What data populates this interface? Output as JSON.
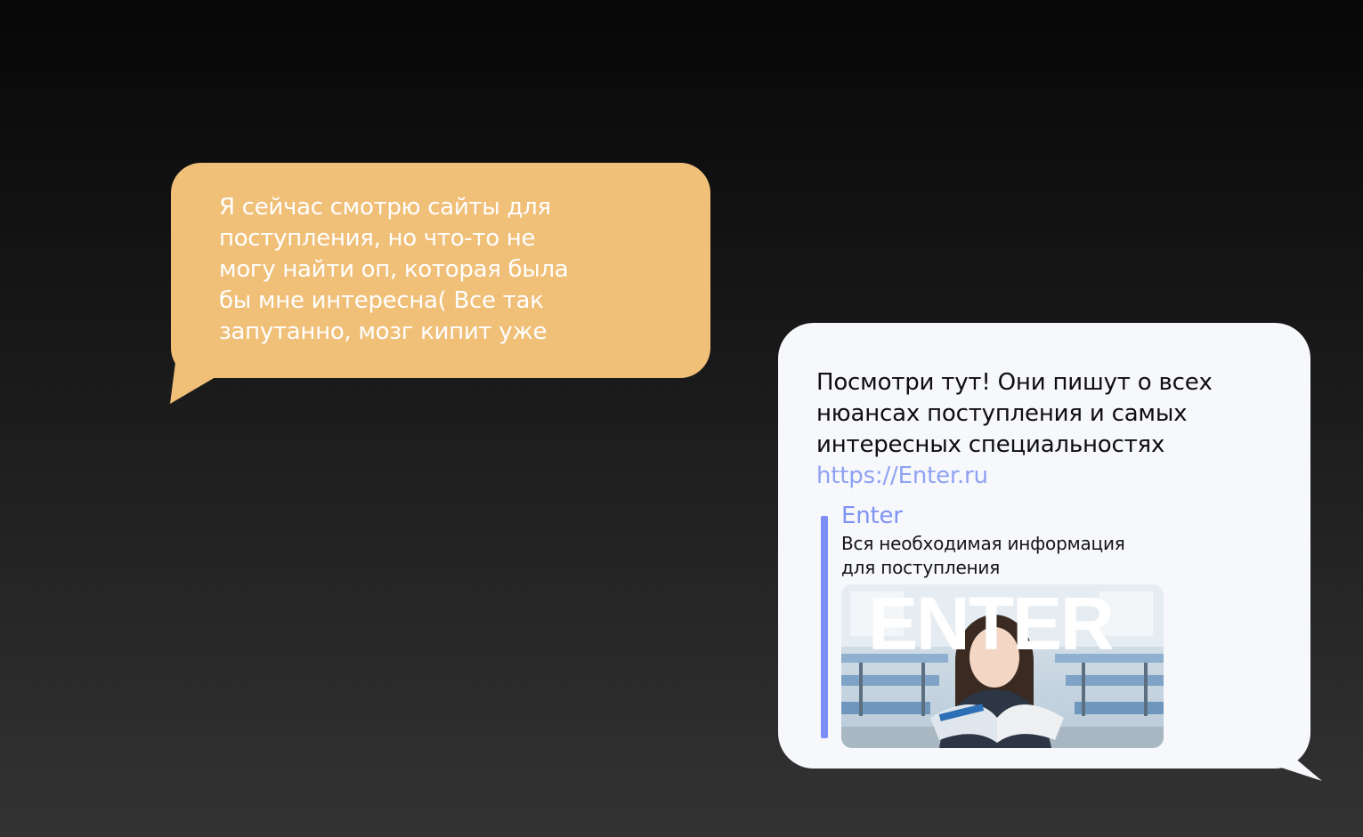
{
  "conversation": {
    "incoming": {
      "text": "Я сейчас смотрю сайты для поступления, но что-то не могу найти оп, которая была бы мне интересна( Все так запутанно, мозг кипит уже",
      "bubble_color": "#f0bf78",
      "text_color": "#ffffff"
    },
    "outgoing": {
      "text": "Посмотри тут! Они пишут о всех нюансах поступления и самых интересных специальностях",
      "link": "https://Enter.ru",
      "bubble_color": "#f7f8fc",
      "text_color": "#0e0e10",
      "link_color": "#8ea2f2",
      "preview": {
        "title": "Enter",
        "description": "Вся необходимая информация для поступления",
        "image_wordmark": "ENTER",
        "image_subject": "student-reading-book-in-classroom",
        "accent_color": "#7c8df5"
      }
    }
  }
}
